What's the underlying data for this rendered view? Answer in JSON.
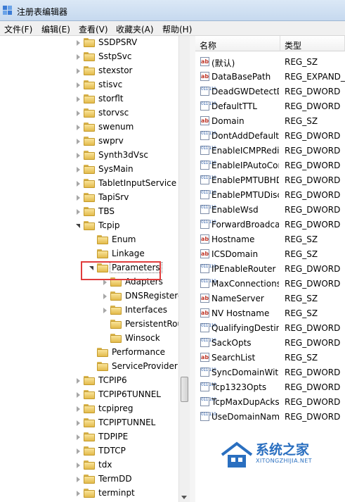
{
  "window": {
    "title": "注册表编辑器"
  },
  "menu": [
    {
      "label": "文件(F)"
    },
    {
      "label": "编辑(E)"
    },
    {
      "label": "查看(V)"
    },
    {
      "label": "收藏夹(A)"
    },
    {
      "label": "帮助(H)"
    }
  ],
  "tree": {
    "nodes": [
      {
        "label": "SSDPSRV",
        "expander": "collapsed",
        "depth": 0
      },
      {
        "label": "SstpSvc",
        "expander": "collapsed",
        "depth": 0
      },
      {
        "label": "stexstor",
        "expander": "collapsed",
        "depth": 0
      },
      {
        "label": "stisvc",
        "expander": "collapsed",
        "depth": 0
      },
      {
        "label": "storflt",
        "expander": "collapsed",
        "depth": 0
      },
      {
        "label": "storvsc",
        "expander": "collapsed",
        "depth": 0
      },
      {
        "label": "swenum",
        "expander": "collapsed",
        "depth": 0
      },
      {
        "label": "swprv",
        "expander": "collapsed",
        "depth": 0
      },
      {
        "label": "Synth3dVsc",
        "expander": "collapsed",
        "depth": 0
      },
      {
        "label": "SysMain",
        "expander": "collapsed",
        "depth": 0
      },
      {
        "label": "TabletInputService",
        "expander": "collapsed",
        "depth": 0
      },
      {
        "label": "TapiSrv",
        "expander": "collapsed",
        "depth": 0
      },
      {
        "label": "TBS",
        "expander": "collapsed",
        "depth": 0
      },
      {
        "label": "Tcpip",
        "expander": "expanded",
        "depth": 0
      },
      {
        "label": "Enum",
        "expander": "none",
        "depth": 1
      },
      {
        "label": "Linkage",
        "expander": "none",
        "depth": 1
      },
      {
        "label": "Parameters",
        "expander": "expanded",
        "depth": 1,
        "selected": true
      },
      {
        "label": "Adapters",
        "expander": "collapsed",
        "depth": 2
      },
      {
        "label": "DNSRegisteredAdapters",
        "expander": "collapsed",
        "depth": 2
      },
      {
        "label": "Interfaces",
        "expander": "collapsed",
        "depth": 2
      },
      {
        "label": "PersistentRoutes",
        "expander": "none",
        "depth": 2
      },
      {
        "label": "Winsock",
        "expander": "none",
        "depth": 2
      },
      {
        "label": "Performance",
        "expander": "none",
        "depth": 1
      },
      {
        "label": "ServiceProvider",
        "expander": "none",
        "depth": 1
      },
      {
        "label": "TCPIP6",
        "expander": "collapsed",
        "depth": 0
      },
      {
        "label": "TCPIP6TUNNEL",
        "expander": "collapsed",
        "depth": 0
      },
      {
        "label": "tcpipreg",
        "expander": "collapsed",
        "depth": 0
      },
      {
        "label": "TCPIPTUNNEL",
        "expander": "collapsed",
        "depth": 0
      },
      {
        "label": "TDPIPE",
        "expander": "collapsed",
        "depth": 0
      },
      {
        "label": "TDTCP",
        "expander": "collapsed",
        "depth": 0
      },
      {
        "label": "tdx",
        "expander": "collapsed",
        "depth": 0
      },
      {
        "label": "TermDD",
        "expander": "collapsed",
        "depth": 0
      },
      {
        "label": "terminpt",
        "expander": "collapsed",
        "depth": 0
      }
    ]
  },
  "list": {
    "headers": {
      "name": "名称",
      "type": "类型"
    },
    "rows": [
      {
        "name": "(默认)",
        "type": "REG_SZ",
        "icon": "string-value-icon"
      },
      {
        "name": "DataBasePath",
        "type": "REG_EXPAND_SZ",
        "icon": "string-value-icon"
      },
      {
        "name": "DeadGWDetectDefault",
        "type": "REG_DWORD",
        "icon": "binary-value-icon"
      },
      {
        "name": "DefaultTTL",
        "type": "REG_DWORD",
        "icon": "binary-value-icon"
      },
      {
        "name": "Domain",
        "type": "REG_SZ",
        "icon": "string-value-icon"
      },
      {
        "name": "DontAddDefaultGatewayDefault",
        "type": "REG_DWORD",
        "icon": "binary-value-icon"
      },
      {
        "name": "EnableICMPRedirect",
        "type": "REG_DWORD",
        "icon": "binary-value-icon"
      },
      {
        "name": "EnableIPAutoConfigurationLimits",
        "type": "REG_DWORD",
        "icon": "binary-value-icon"
      },
      {
        "name": "EnablePMTUBHDetect",
        "type": "REG_DWORD",
        "icon": "binary-value-icon"
      },
      {
        "name": "EnablePMTUDiscovery",
        "type": "REG_DWORD",
        "icon": "binary-value-icon"
      },
      {
        "name": "EnableWsd",
        "type": "REG_DWORD",
        "icon": "binary-value-icon"
      },
      {
        "name": "ForwardBroadcasts",
        "type": "REG_DWORD",
        "icon": "binary-value-icon"
      },
      {
        "name": "Hostname",
        "type": "REG_SZ",
        "icon": "string-value-icon"
      },
      {
        "name": "ICSDomain",
        "type": "REG_SZ",
        "icon": "string-value-icon"
      },
      {
        "name": "IPEnableRouter",
        "type": "REG_DWORD",
        "icon": "binary-value-icon"
      },
      {
        "name": "MaxConnectionsPerServer",
        "type": "REG_DWORD",
        "icon": "binary-value-icon"
      },
      {
        "name": "NameServer",
        "type": "REG_SZ",
        "icon": "string-value-icon"
      },
      {
        "name": "NV Hostname",
        "type": "REG_SZ",
        "icon": "string-value-icon"
      },
      {
        "name": "QualifyingDestinationThreshold",
        "type": "REG_DWORD",
        "icon": "binary-value-icon"
      },
      {
        "name": "SackOpts",
        "type": "REG_DWORD",
        "icon": "binary-value-icon"
      },
      {
        "name": "SearchList",
        "type": "REG_SZ",
        "icon": "string-value-icon"
      },
      {
        "name": "SyncDomainWithMembership",
        "type": "REG_DWORD",
        "icon": "binary-value-icon"
      },
      {
        "name": "Tcp1323Opts",
        "type": "REG_DWORD",
        "icon": "binary-value-icon"
      },
      {
        "name": "TcpMaxDupAcks",
        "type": "REG_DWORD",
        "icon": "binary-value-icon"
      },
      {
        "name": "UseDomainNameDevolution",
        "type": "REG_DWORD",
        "icon": "binary-value-icon"
      }
    ]
  },
  "watermark": {
    "text": "系统之家",
    "subtext": "XITONGZHIJIA.NET"
  },
  "colors": {
    "highlight_border": "#e03c3c",
    "watermark": "#2a6fc0"
  }
}
